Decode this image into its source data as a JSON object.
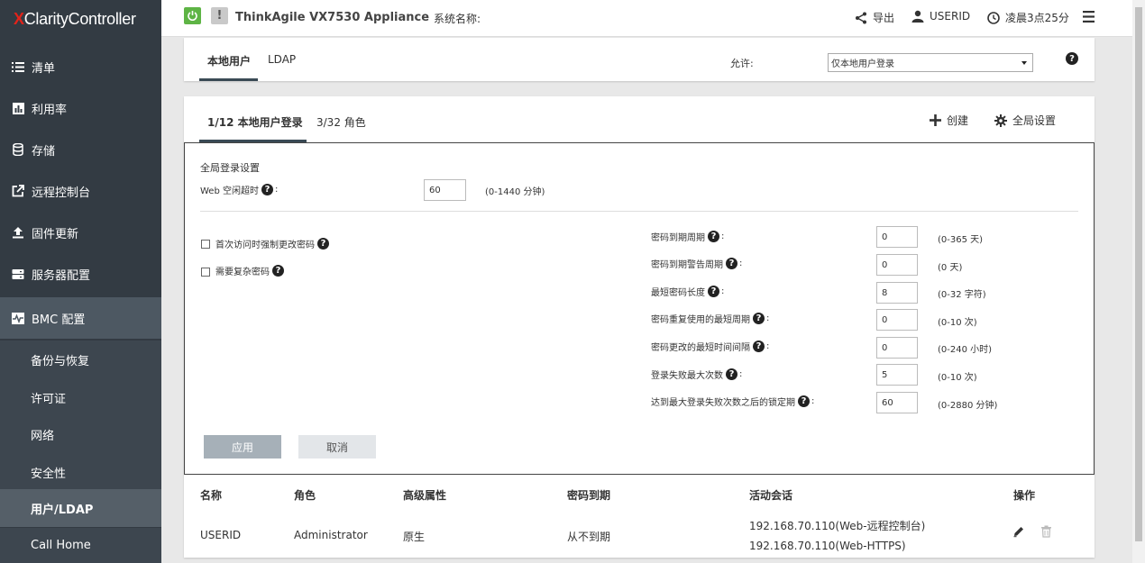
{
  "brand": {
    "x": "X",
    "clarity": "Clarity",
    "controller": " Controller"
  },
  "nav": [
    {
      "label": "清单",
      "icon": "list-icon"
    },
    {
      "label": "利用率",
      "icon": "bar-chart-icon"
    },
    {
      "label": "存储",
      "icon": "database-icon"
    },
    {
      "label": "远程控制台",
      "icon": "external-link-icon"
    },
    {
      "label": "固件更新",
      "icon": "upload-icon"
    },
    {
      "label": "服务器配置",
      "icon": "server-icon"
    },
    {
      "label": "BMC 配置",
      "icon": "pulse-icon"
    }
  ],
  "subnav": [
    {
      "label": "备份与恢复"
    },
    {
      "label": "许可证"
    },
    {
      "label": "网络"
    },
    {
      "label": "安全性"
    },
    {
      "label": "用户/LDAP"
    },
    {
      "label": "Call Home"
    }
  ],
  "header": {
    "warn_glyph": "!",
    "appliance": "ThinkAgile VX7530 Appliance",
    "sysname_label": "系统名称:",
    "export_label": "导出",
    "user_label": "USERID",
    "time_label": "凌晨3点25分"
  },
  "top_tabs": {
    "local": "本地用户",
    "ldap": "LDAP",
    "allow_label": "允许:",
    "allow_value": "仅本地用户登录"
  },
  "sub_tabs": {
    "logins": "1/12  本地用户登录",
    "roles": "3/32  角色",
    "create": "创建",
    "global": "全局设置"
  },
  "global_login": {
    "title": "全局登录设置",
    "web_timeout_label": "Web 空闲超时",
    "web_timeout_value": "60",
    "web_timeout_hint": "(0-1440 分钟)"
  },
  "checkboxes": [
    {
      "label": "首次访问时强制更改密码",
      "checked": false
    },
    {
      "label": "需要复杂密码",
      "checked": false
    }
  ],
  "password_fields": [
    {
      "label": "密码到期周期",
      "value": "0",
      "hint": "(0-365 天)"
    },
    {
      "label": "密码到期警告周期",
      "value": "0",
      "hint": "(0 天)"
    },
    {
      "label": "最短密码长度",
      "value": "8",
      "hint": "(0-32 字符)"
    },
    {
      "label": "密码重复使用的最短周期",
      "value": "0",
      "hint": "(0-10 次)"
    },
    {
      "label": "密码更改的最短时间间隔",
      "value": "0",
      "hint": "(0-240 小时)"
    },
    {
      "label": "登录失败最大次数",
      "value": "5",
      "hint": "(0-10 次)"
    },
    {
      "label": "达到最大登录失败次数之后的锁定期",
      "value": "60",
      "hint": "(0-2880 分钟)"
    }
  ],
  "buttons": {
    "apply": "应用",
    "cancel": "取消"
  },
  "table": {
    "headers": [
      "名称",
      "角色",
      "高级属性",
      "密码到期",
      "活动会话",
      "操作"
    ],
    "row": {
      "name": "USERID",
      "role": "Administrator",
      "attr": "原生",
      "expire": "从不到期",
      "session1": "192.168.70.110(Web-远程控制台)",
      "session2": "192.168.70.110(Web-HTTPS)"
    }
  },
  "colors": {
    "power": "#5eb445",
    "sidebar": "#333b43",
    "brand_red": "#e2231a"
  }
}
